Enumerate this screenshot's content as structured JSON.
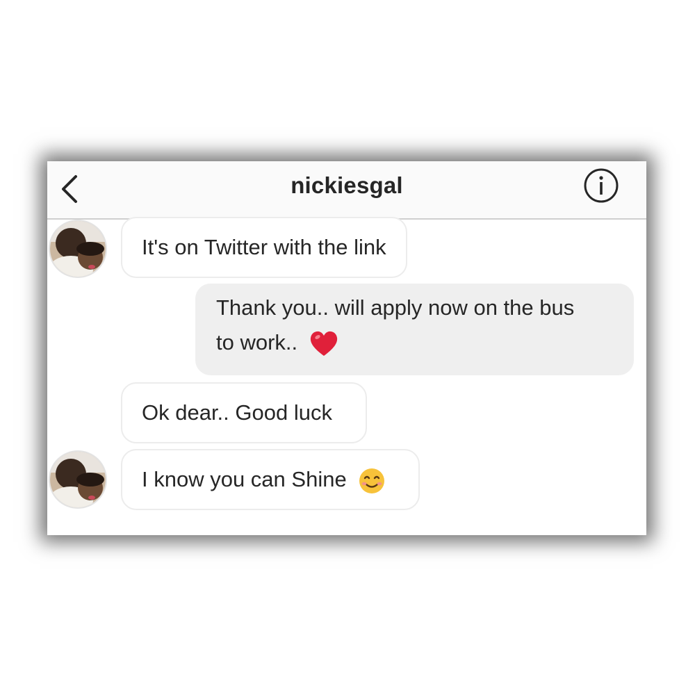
{
  "header": {
    "title": "nickiesgal",
    "back_icon": "chevron-left-icon",
    "info_icon": "info-circle-icon"
  },
  "messages": [
    {
      "direction": "incoming",
      "text": "It's on Twitter with the link",
      "avatar": true
    },
    {
      "direction": "outgoing",
      "line1": "Thank you.. will apply now on the bus",
      "line2": "to work..",
      "emoji": "red-heart-emoji"
    },
    {
      "direction": "incoming",
      "text": "Ok dear.. Good luck",
      "avatar": false
    },
    {
      "direction": "incoming",
      "text": "I know you can Shine",
      "emoji": "smiling-face-emoji",
      "avatar": true
    }
  ],
  "colors": {
    "header_bg": "#fafafa",
    "outgoing_bubble": "#efefef",
    "incoming_border": "#ececec",
    "text": "#262626",
    "heart": "#e0203a",
    "smile": "#f7c23a"
  }
}
